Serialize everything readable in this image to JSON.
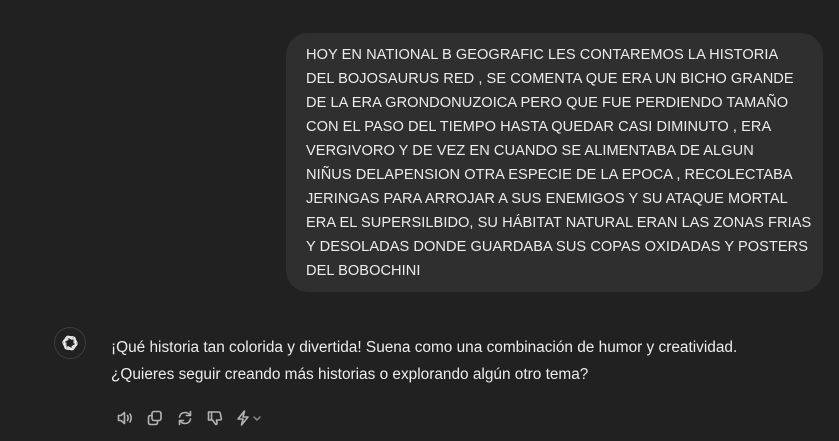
{
  "user_message": {
    "lines": [
      "HOY EN NATIONAL B GEOGRAFIC LES CONTAREMOS LA HISTORIA",
      "DEL BOJOSAURUS RED , SE COMENTA QUE ERA UN BICHO GRANDE",
      "DE LA ERA GRONDONUZOICA PERO QUE FUE PERDIENDO TAMAÑO",
      "CON EL PASO DEL TIEMPO HASTA QUEDAR CASI DIMINUTO , ERA",
      "VERGIVORO Y DE VEZ EN CUANDO SE ALIMENTABA DE ALGUN",
      "NIÑUS DELAPENSION OTRA ESPECIE DE LA EPOCA , RECOLECTABA",
      "JERINGAS PARA ARROJAR A SUS ENEMIGOS Y SU ATAQUE MORTAL",
      "ERA EL SUPERSILBIDO, SU HÁBITAT NATURAL ERAN LAS ZONAS FRIAS",
      "Y DESOLADAS DONDE GUARDABA SUS COPAS OXIDADAS Y POSTERS",
      "DEL BOBOCHINI"
    ]
  },
  "assistant_message": {
    "avatar_icon": "openai-logo-icon",
    "lines": [
      "¡Qué historia tan colorida y divertida! Suena como una combinación de humor y creatividad.",
      "¿Quieres seguir creando más historias o explorando algún otro tema?"
    ]
  },
  "actions": [
    {
      "name": "read-aloud-button",
      "icon": "speaker-icon"
    },
    {
      "name": "copy-button",
      "icon": "copy-icon"
    },
    {
      "name": "regenerate-button",
      "icon": "refresh-icon"
    },
    {
      "name": "bad-response-button",
      "icon": "thumbs-down-icon"
    },
    {
      "name": "switch-model-button",
      "icon": "sparkle-icon"
    }
  ],
  "colors": {
    "background": "#212121",
    "user_bubble": "#2f2f2f",
    "text": "#ececec",
    "icon": "#b4b4b4"
  }
}
